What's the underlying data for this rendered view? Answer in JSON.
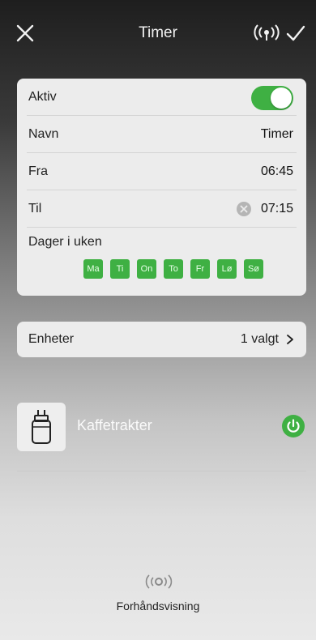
{
  "header": {
    "title": "Timer",
    "close_icon": "close-icon",
    "signal_icon": "signal-icon",
    "confirm_icon": "checkmark-icon"
  },
  "settings": {
    "active": {
      "label": "Aktiv",
      "enabled": true
    },
    "name": {
      "label": "Navn",
      "value": "Timer"
    },
    "from": {
      "label": "Fra",
      "value": "06:45"
    },
    "to": {
      "label": "Til",
      "value": "07:15"
    },
    "days": {
      "label": "Dager i uken",
      "items": [
        "Ma",
        "Ti",
        "On",
        "To",
        "Fr",
        "Lø",
        "Sø"
      ]
    }
  },
  "devices": {
    "label": "Enheter",
    "value": "1 valgt"
  },
  "device": {
    "name": "Kaffetrakter",
    "on": true
  },
  "preview": {
    "label": "Forhåndsvisning"
  },
  "colors": {
    "accent": "#3fb043",
    "card": "#ececec"
  }
}
